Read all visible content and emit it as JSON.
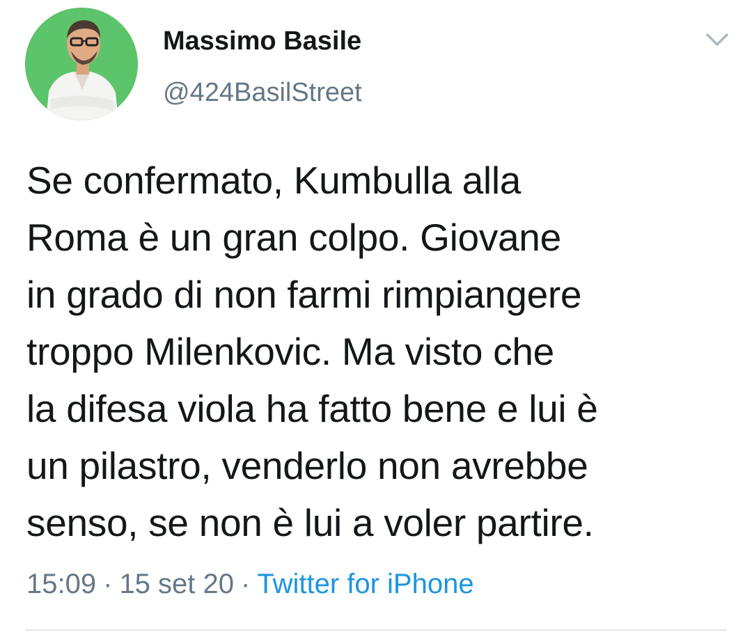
{
  "user": {
    "display_name": "Massimo Basile",
    "handle": "@424BasilStreet",
    "avatar_icon": "profile-photo"
  },
  "menu": {
    "icon": "chevron-down-icon"
  },
  "tweet": {
    "text": "Se confermato, Kumbulla alla\nRoma è un gran colpo. Giovane\nin grado di non farmi rimpiangere\ntroppo Milenkovic. Ma visto che\nla difesa viola ha fatto bene e lui è\nun pilastro, venderlo non avrebbe\nsenso, se non è lui a voler partire.",
    "time": "15:09",
    "date": "15 set 20",
    "separator": "·",
    "source": "Twitter for iPhone"
  },
  "colors": {
    "text": "#14171a",
    "secondary": "#657786",
    "link": "#1b95e0",
    "avatar_bg": "#5cc46a",
    "divider": "#e1e8ed"
  }
}
